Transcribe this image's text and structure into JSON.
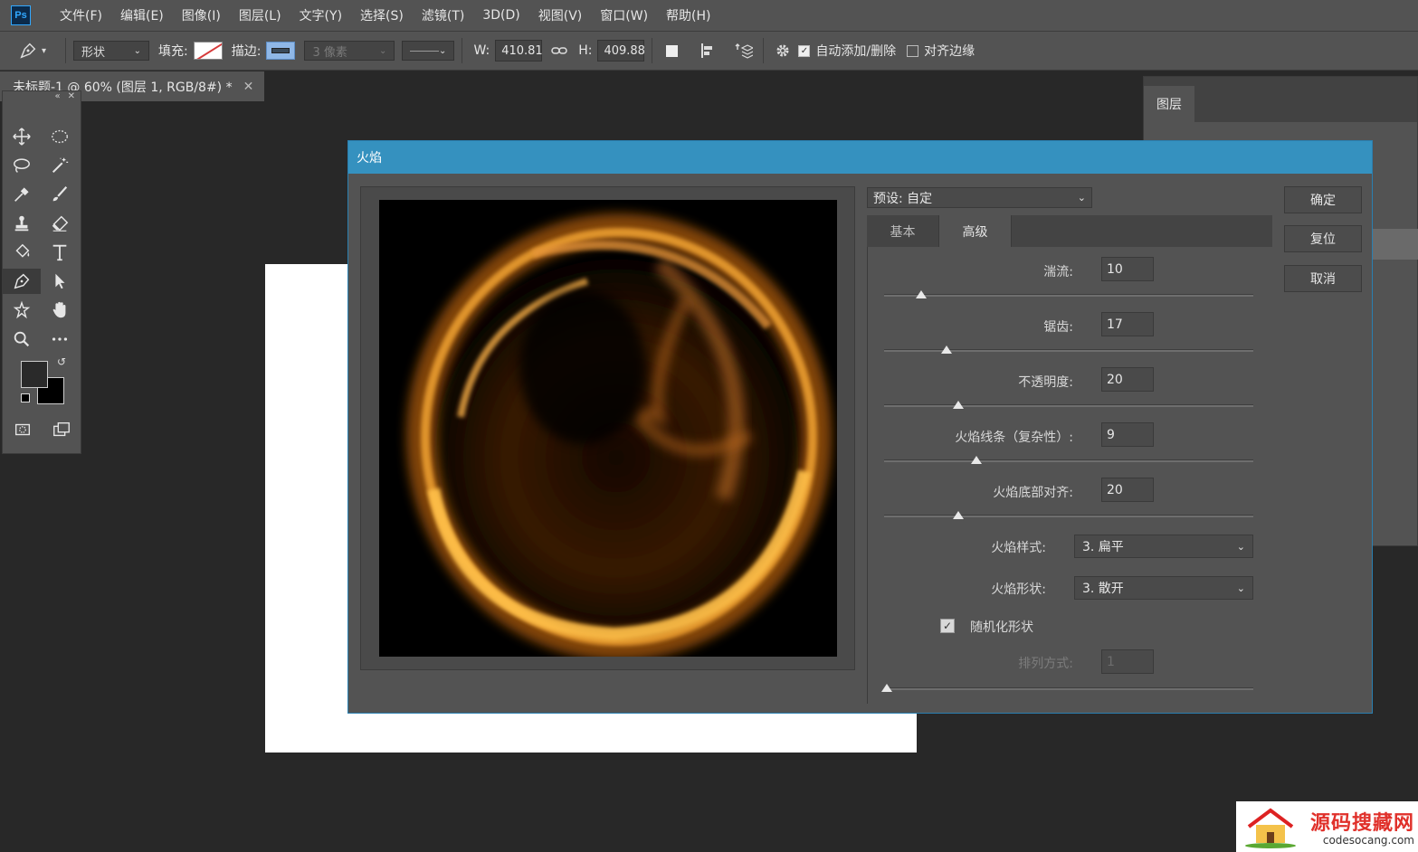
{
  "app": {
    "logo": "Ps"
  },
  "menu": [
    "文件(F)",
    "编辑(E)",
    "图像(I)",
    "图层(L)",
    "文字(Y)",
    "选择(S)",
    "滤镜(T)",
    "3D(D)",
    "视图(V)",
    "窗口(W)",
    "帮助(H)"
  ],
  "options": {
    "mode": "形状",
    "fill_label": "填充:",
    "stroke_label": "描边:",
    "stroke_width": "3 像素",
    "w_label": "W:",
    "w_value": "410.81",
    "h_label": "H:",
    "h_value": "409.88",
    "auto_add_delete": "自动添加/删除",
    "align_edges": "对齐边缘"
  },
  "document_tab": {
    "title": "未标题-1 @ 60% (图层 1, RGB/8#) *"
  },
  "layers_panel": {
    "tab": "图层"
  },
  "dialog": {
    "title": "火焰",
    "preset": "预设: 自定",
    "tabs": [
      "基本",
      "高级"
    ],
    "active_tab": "高级",
    "fields": [
      {
        "label": "湍流:",
        "value": "10",
        "level": 0.1
      },
      {
        "label": "锯齿:",
        "value": "17",
        "level": 0.17
      },
      {
        "label": "不透明度:",
        "value": "20",
        "level": 0.2
      },
      {
        "label": "火焰线条（复杂性）:",
        "value": "9",
        "level": 0.25
      },
      {
        "label": "火焰底部对齐:",
        "value": "20",
        "level": 0.2
      }
    ],
    "style_label": "火焰样式:",
    "style_value": "3. 扁平",
    "shape_label": "火焰形状:",
    "shape_value": "3. 散开",
    "randomize_label": "随机化形状",
    "arrange_label": "排列方式:",
    "arrange_value": "1",
    "buttons": {
      "ok": "确定",
      "reset": "复位",
      "cancel": "取消"
    }
  },
  "watermark": {
    "title": "源码搜藏网",
    "url": "codesocang.com"
  }
}
